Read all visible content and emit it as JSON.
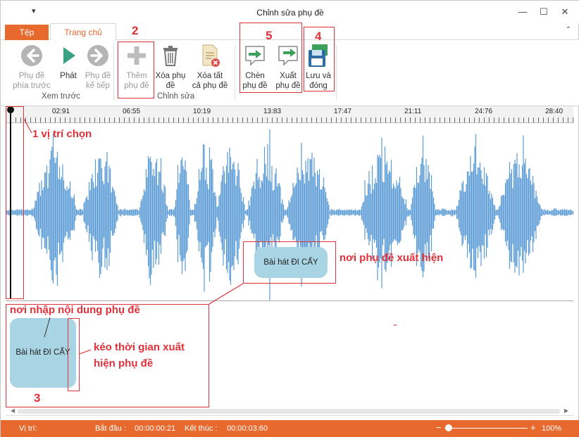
{
  "window": {
    "title": "Chỉnh sửa phụ đề",
    "quick_access": "▾",
    "minimize": "—",
    "maximize": "☐",
    "close": "✕"
  },
  "tabs": {
    "file": "Tệp",
    "home": "Trang chủ",
    "collapse": "⌃"
  },
  "ribbon": {
    "prev_sub": [
      "Phụ đề",
      "phía trước"
    ],
    "play": "Phát",
    "next_sub": [
      "Phụ đề",
      "kế tiếp"
    ],
    "group_preview": "Xem trước",
    "add_sub": [
      "Thêm",
      "phụ đề"
    ],
    "delete_sub": [
      "Xóa phụ",
      "đề"
    ],
    "delete_all": [
      "Xóa tất",
      "cả phụ đề"
    ],
    "group_edit": "Chỉnh sửa",
    "insert_sub": [
      "Chèn",
      "phụ đề"
    ],
    "export_sub": [
      "Xuất",
      "phụ đề"
    ],
    "save_close": [
      "Lưu và",
      "đóng"
    ]
  },
  "ruler": {
    "labels": [
      "02:91",
      "06:55",
      "10:19",
      "13:83",
      "17:47",
      "21:11",
      "24:76",
      "28:40"
    ]
  },
  "subtitle": {
    "text": "Bài hát ĐI CẤY"
  },
  "annotations": {
    "n1": "1 vị trí chọn",
    "n2": "2",
    "n3": "3",
    "n4": "4",
    "n5": "5",
    "sub_appear": "nơi phụ đề xuất hiện",
    "input_area": "nơi nhập nội dung phụ đề",
    "drag_time": [
      "kéo thời gian xuất",
      "hiện phụ đề"
    ]
  },
  "status": {
    "position_label": "Vị trí:",
    "start_label": "Bắt đầu :",
    "start_value": "00:00:00:21",
    "end_label": "Kết thúc :",
    "end_value": "00:00:03:60",
    "zoom_minus": "−",
    "zoom_plus": "+",
    "zoom_value": "100%"
  },
  "colors": {
    "accent": "#e8692e",
    "wave": "#5b9bd5",
    "annotation": "#e0303a",
    "subtitle_bg": "#a9d4e3"
  }
}
